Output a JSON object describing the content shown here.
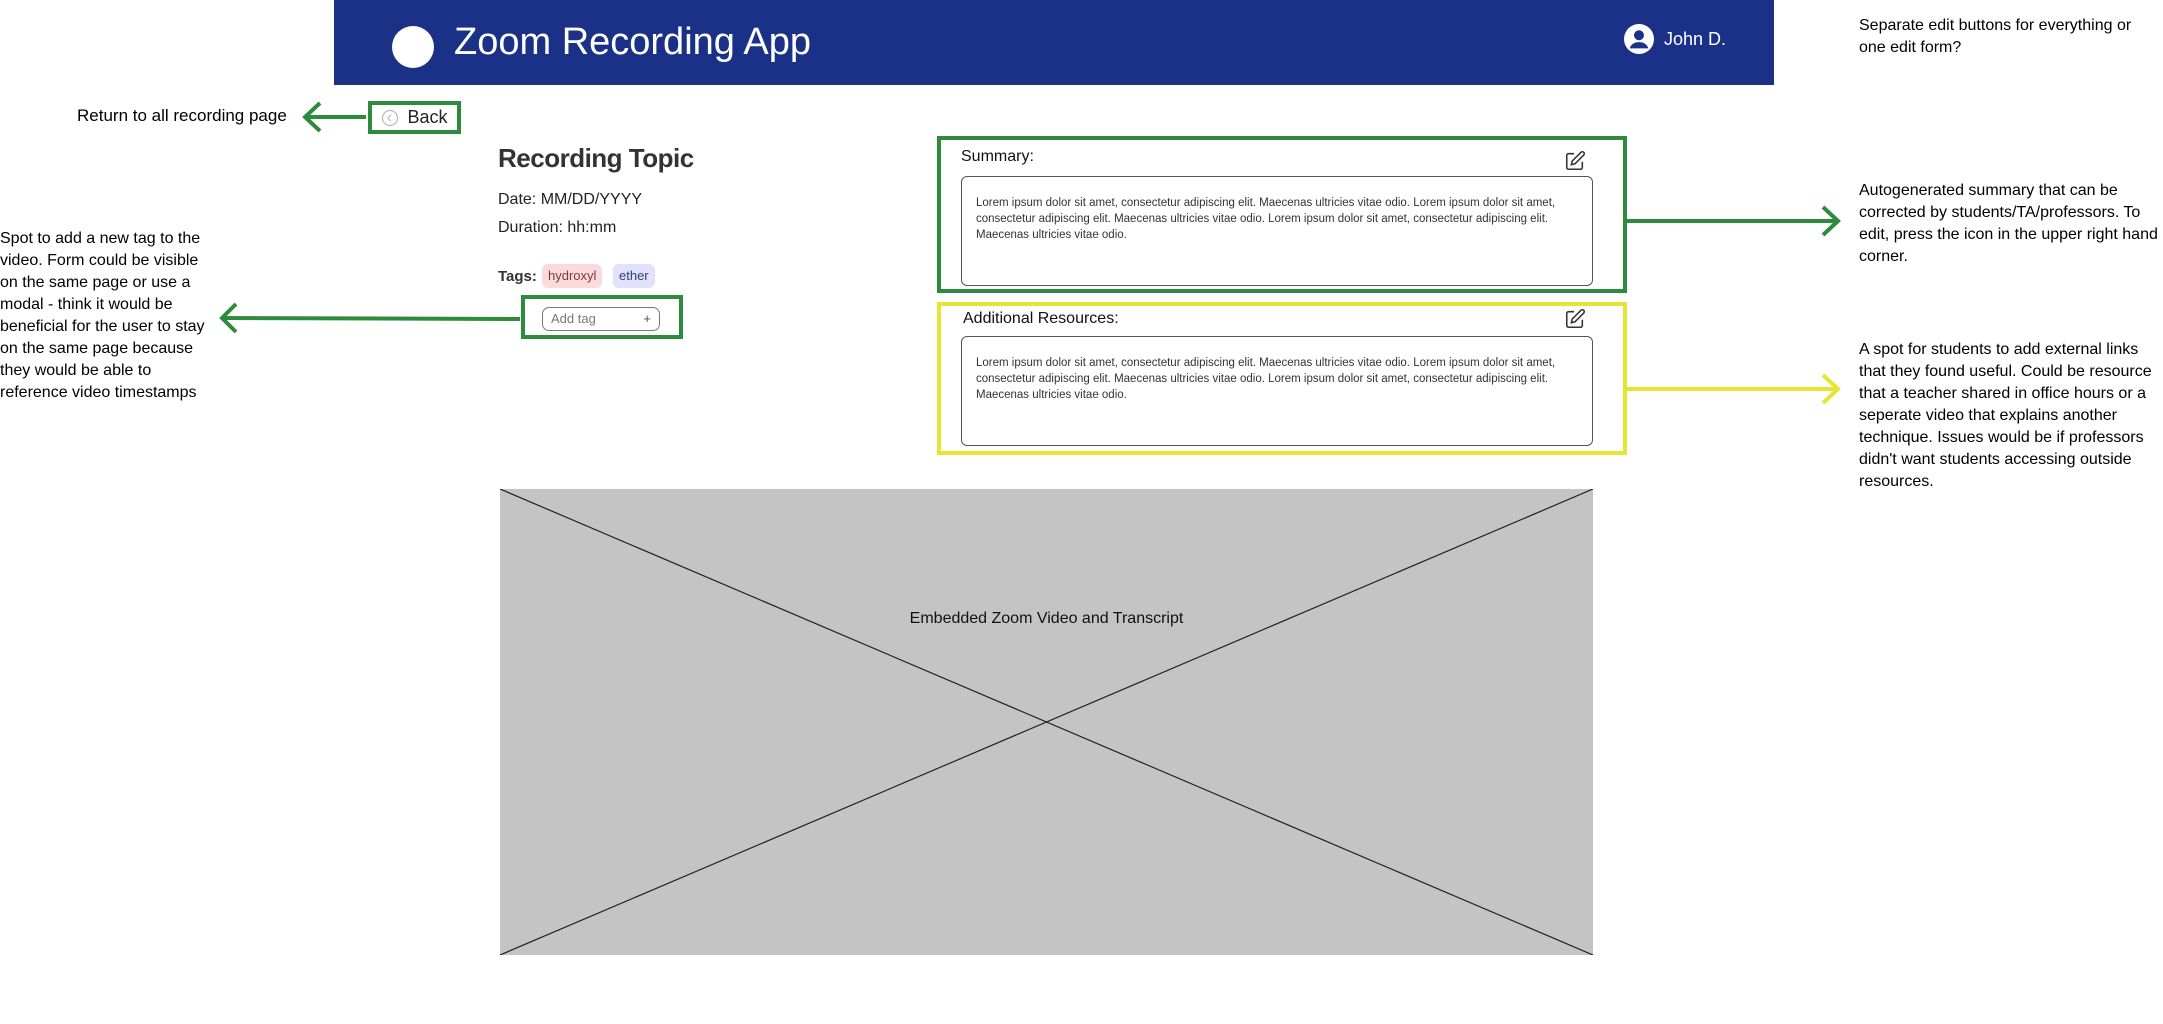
{
  "header": {
    "app_title": "Zoom Recording App",
    "user_name": "John D."
  },
  "nav": {
    "back_label": "Back"
  },
  "recording": {
    "title": "Recording Topic",
    "date": "Date: MM/DD/YYYY",
    "duration": "Duration: hh:mm",
    "tags_label": "Tags:",
    "tags": [
      "hydroxyl",
      "ether"
    ],
    "add_tag_placeholder": "Add tag",
    "add_tag_icon": "+"
  },
  "summary": {
    "title": "Summary:",
    "text": "Lorem ipsum dolor sit amet, consectetur adipiscing elit. Maecenas ultricies vitae odio. Lorem ipsum dolor sit amet, consectetur adipiscing elit. Maecenas ultricies vitae odio. Lorem ipsum dolor sit amet, consectetur adipiscing elit. Maecenas ultricies vitae odio."
  },
  "resources": {
    "title": "Additional Resources:",
    "text": "Lorem ipsum dolor sit amet, consectetur adipiscing elit. Maecenas ultricies vitae odio. Lorem ipsum dolor sit amet, consectetur adipiscing elit. Maecenas ultricies vitae odio. Lorem ipsum dolor sit amet, consectetur adipiscing elit. Maecenas ultricies vitae odio."
  },
  "video": {
    "label": "Embedded Zoom Video and Transcript"
  },
  "annotations": {
    "back": "Return to all recording page",
    "tag": "Spot to add a new tag to the video. Form could be visible on the same page or use a modal - think it would be beneficial for the user to stay on the same page because they would be able to reference video timestamps",
    "edit": "Separate edit buttons for everything or one edit form?",
    "summary": "Autogenerated summary that can be corrected by students/TA/professors. To edit, press the icon in the upper right hand corner.",
    "resources": "A spot for students to add external links that they found useful. Could be resource that a teacher shared in office hours or a seperate video that explains another technique. Issues would be if professors didn't want students accessing outside resources."
  },
  "colors": {
    "header_bg": "#1b3187",
    "annotation_green": "#2e8b3d",
    "annotation_yellow": "#e6e632",
    "video_bg": "#c4c4c4"
  },
  "icons": {
    "user": "user-avatar-icon",
    "back": "arrow-left-circle-icon",
    "edit": "pencil-square-icon"
  }
}
